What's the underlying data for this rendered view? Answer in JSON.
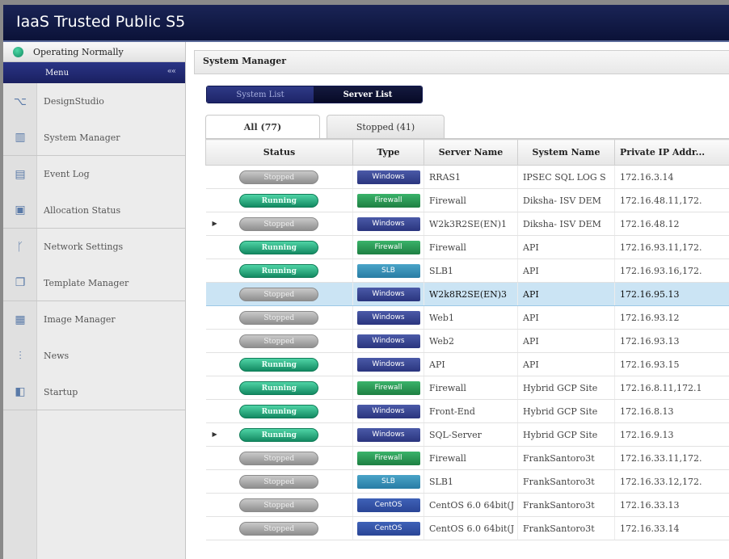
{
  "app": {
    "title": "IaaS Trusted Public S5"
  },
  "sidebar": {
    "status_text": "Operating Normally",
    "menu_label": "Menu",
    "collapse_glyph": "««",
    "items": [
      {
        "label": "DesignStudio",
        "icon": "design-icon",
        "glyph": "⌥"
      },
      {
        "label": "System Manager",
        "icon": "system-icon",
        "glyph": "▥"
      },
      {
        "label": "Event Log",
        "icon": "log-icon",
        "glyph": "▤"
      },
      {
        "label": "Allocation Status",
        "icon": "allocation-icon",
        "glyph": "▣"
      },
      {
        "label": "Network Settings",
        "icon": "network-icon",
        "glyph": "ᚴ"
      },
      {
        "label": "Template Manager",
        "icon": "template-icon",
        "glyph": "❐"
      },
      {
        "label": "Image Manager",
        "icon": "image-icon",
        "glyph": "▦"
      },
      {
        "label": "News",
        "icon": "news-icon",
        "glyph": "⫶"
      },
      {
        "label": "Startup",
        "icon": "startup-icon",
        "glyph": "◧"
      }
    ]
  },
  "main": {
    "section_title": "System Manager",
    "subtabs": [
      "System List",
      "Server List"
    ],
    "filter_tabs": [
      "All (77)",
      "Stopped (41)"
    ],
    "columns": [
      "Status",
      "Type",
      "Server Name",
      "System Name",
      "Private IP Addr..."
    ],
    "rows": [
      {
        "status": "Stopped",
        "type": "Windows",
        "server": "RRAS1",
        "system": "IPSEC SQL LOG S",
        "ip": "172.16.3.14"
      },
      {
        "status": "Running",
        "type": "Firewall",
        "server": "Firewall",
        "system": "Diksha- ISV DEM",
        "ip": "172.16.48.11,172."
      },
      {
        "status": "Stopped",
        "type": "Windows",
        "server": "W2k3R2SE(EN)1",
        "system": "Diksha- ISV DEM",
        "ip": "172.16.48.12",
        "expander": "▶"
      },
      {
        "status": "Running",
        "type": "Firewall",
        "server": "Firewall",
        "system": "API",
        "ip": "172.16.93.11,172."
      },
      {
        "status": "Running",
        "type": "SLB",
        "server": "SLB1",
        "system": "API",
        "ip": "172.16.93.16,172."
      },
      {
        "status": "Stopped",
        "type": "Windows",
        "server": "W2k8R2SE(EN)3",
        "system": "API",
        "ip": "172.16.95.13",
        "selected": true
      },
      {
        "status": "Stopped",
        "type": "Windows",
        "server": "Web1",
        "system": "API",
        "ip": "172.16.93.12"
      },
      {
        "status": "Stopped",
        "type": "Windows",
        "server": "Web2",
        "system": "API",
        "ip": "172.16.93.13"
      },
      {
        "status": "Running",
        "type": "Windows",
        "server": "API",
        "system": "API",
        "ip": "172.16.93.15"
      },
      {
        "status": "Running",
        "type": "Firewall",
        "server": "Firewall",
        "system": "Hybrid GCP Site",
        "ip": "172.16.8.11,172.1"
      },
      {
        "status": "Running",
        "type": "Windows",
        "server": "Front-End",
        "system": "Hybrid GCP Site",
        "ip": "172.16.8.13"
      },
      {
        "status": "Running",
        "type": "Windows",
        "server": "SQL-Server",
        "system": "Hybrid GCP Site",
        "ip": "172.16.9.13",
        "expander": "▶"
      },
      {
        "status": "Stopped",
        "type": "Firewall",
        "server": "Firewall",
        "system": "FrankSantoro3t",
        "ip": "172.16.33.11,172."
      },
      {
        "status": "Stopped",
        "type": "SLB",
        "server": "SLB1",
        "system": "FrankSantoro3t",
        "ip": "172.16.33.12,172."
      },
      {
        "status": "Stopped",
        "type": "CentOS",
        "server": "CentOS 6.0 64bit(J",
        "system": "FrankSantoro3t",
        "ip": "172.16.33.13"
      },
      {
        "status": "Stopped",
        "type": "CentOS",
        "server": "CentOS 6.0 64bit(J",
        "system": "FrankSantoro3t",
        "ip": "172.16.33.14"
      }
    ]
  },
  "colors": {
    "titlebar": "#0b1238",
    "running": "#1fa67a",
    "stopped": "#a0a0a0",
    "selected_row": "#cbe4f4"
  }
}
